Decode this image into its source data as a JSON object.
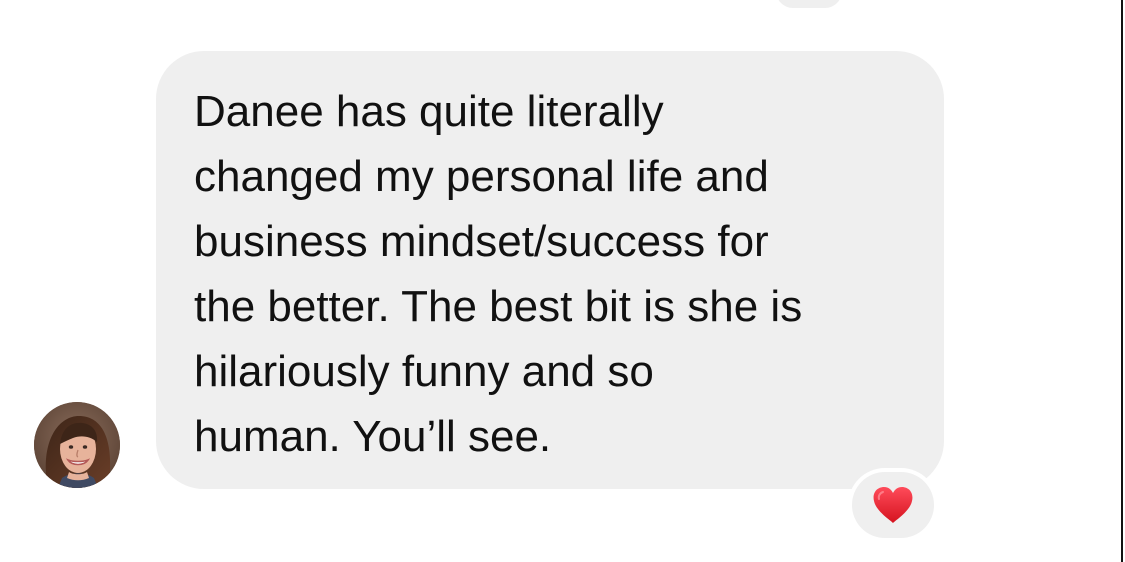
{
  "message": {
    "text": "Danee has quite literally\nchanged my personal life and\nbusiness mindset/success for\nthe better. The best bit is she is\nhilariously funny and so\nhuman. You’ll see."
  },
  "reaction": {
    "icon": "heart-icon",
    "color": "#e0202b"
  },
  "avatar": {
    "icon": "avatar-photo"
  },
  "colors": {
    "bubble_background": "#efefef",
    "text": "#111111",
    "page_background": "#ffffff"
  }
}
